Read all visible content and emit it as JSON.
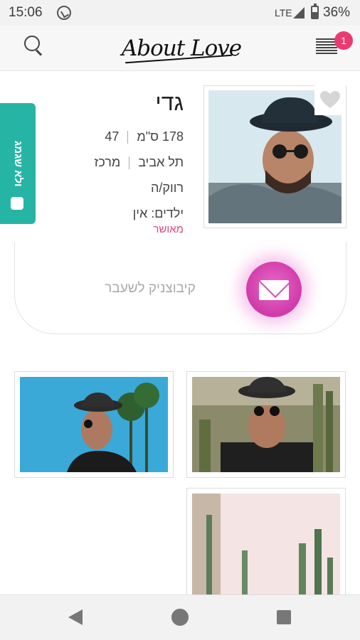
{
  "status_bar": {
    "time": "15:06",
    "network": "LTE",
    "battery": "36%",
    "battery_level_percent": 36
  },
  "header": {
    "logo_text": "About Love",
    "notification_count": "1"
  },
  "profile": {
    "name": "גדי",
    "age": "47",
    "height": "178 ס\"מ",
    "region": "מרכז",
    "city": "תל אביב",
    "status": "רווק/ה",
    "children": "ילדים: אין",
    "approved": "מאושר"
  },
  "video_tab": {
    "label": "ולא שגמג"
  },
  "message_card": {
    "text": "קיבוצניק לשעבר"
  },
  "colors": {
    "accent_pink": "#ec3a6e",
    "video_tab_teal": "#26b5a5",
    "mail_button": "#cf3aa8",
    "approved_text": "#e0457b"
  },
  "icons": {
    "search": "search-icon",
    "menu": "menu-icon",
    "heart": "heart-icon",
    "mail": "mail-icon",
    "video": "video-icon",
    "whatsapp": "whatsapp-icon",
    "signal": "signal-icon",
    "battery": "battery-icon",
    "back": "back-icon",
    "home": "home-icon",
    "recents": "recents-icon"
  }
}
